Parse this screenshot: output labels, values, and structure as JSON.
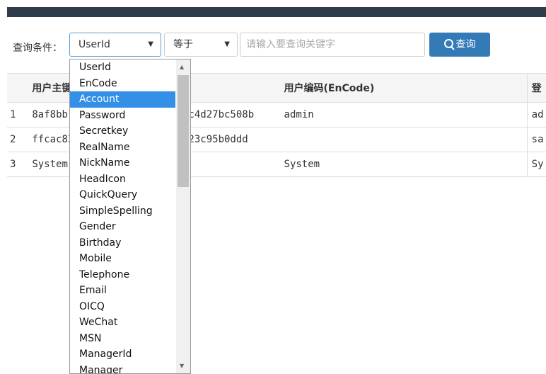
{
  "search": {
    "label": "查询条件：",
    "field_selected": "UserId",
    "operator_selected": "等于",
    "placeholder": "请输入要查询关键字",
    "button_label": "查询"
  },
  "table": {
    "headers": [
      "",
      "用户主键",
      "用户编码(EnCode)",
      "登"
    ],
    "rows": [
      {
        "num": "1",
        "id": "8af8bb",
        "id_tail": "4c4d27bc508b",
        "encode": "admin",
        "login": "ad"
      },
      {
        "num": "2",
        "id": "ffcac83",
        "id_tail": "723c95b0ddd",
        "encode": "",
        "login": "sa"
      },
      {
        "num": "3",
        "id": "System",
        "id_tail": "",
        "encode": "System",
        "login": "Sy"
      }
    ]
  },
  "dropdown": {
    "options": [
      "UserId",
      "EnCode",
      "Account",
      "Password",
      "Secretkey",
      "RealName",
      "NickName",
      "HeadIcon",
      "QuickQuery",
      "SimpleSpelling",
      "Gender",
      "Birthday",
      "Mobile",
      "Telephone",
      "Email",
      "OICQ",
      "WeChat",
      "MSN",
      "ManagerId",
      "Manager"
    ],
    "highlighted": "Account"
  },
  "icons": {
    "search_button_icon": "search-icon",
    "select_caret": "caret-down-icon"
  },
  "colors": {
    "topbar": "#2f3d4a",
    "primary": "#337ab7",
    "highlight": "#3390e6"
  }
}
